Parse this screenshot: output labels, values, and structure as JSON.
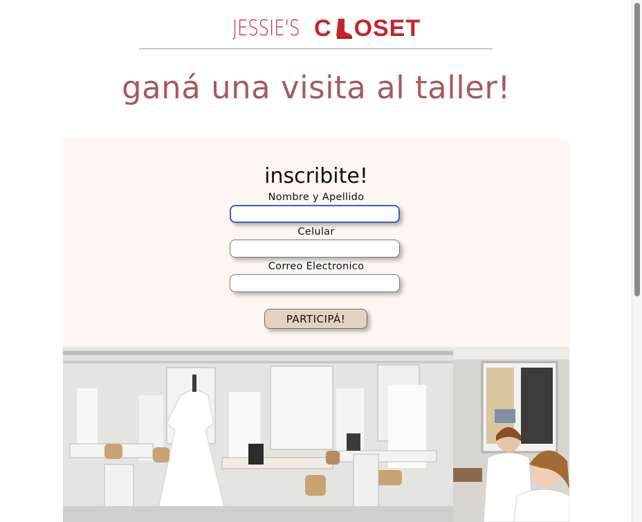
{
  "header": {
    "logo_left": "JESSIE'S",
    "logo_right_c": "C",
    "logo_right_rest": "OSET",
    "logo_color": "#c4252a"
  },
  "headline": "ganá una visita al taller!",
  "form": {
    "title": "inscribite!",
    "fields": [
      {
        "label": "Nombre y Apellido",
        "value": "",
        "focused": true
      },
      {
        "label": "Celular",
        "value": ""
      },
      {
        "label": "Correo Electronico",
        "value": ""
      }
    ],
    "submit_label": "PARTICIPÁ!"
  },
  "colors": {
    "headline": "#a65a5a",
    "panel_bg": "#fdf6f1",
    "button_bg": "#e3d2c2",
    "focus_border": "#2f63c9"
  },
  "images": {
    "main": "atelier-workshop-photo",
    "side": "seamstresses-photo"
  }
}
